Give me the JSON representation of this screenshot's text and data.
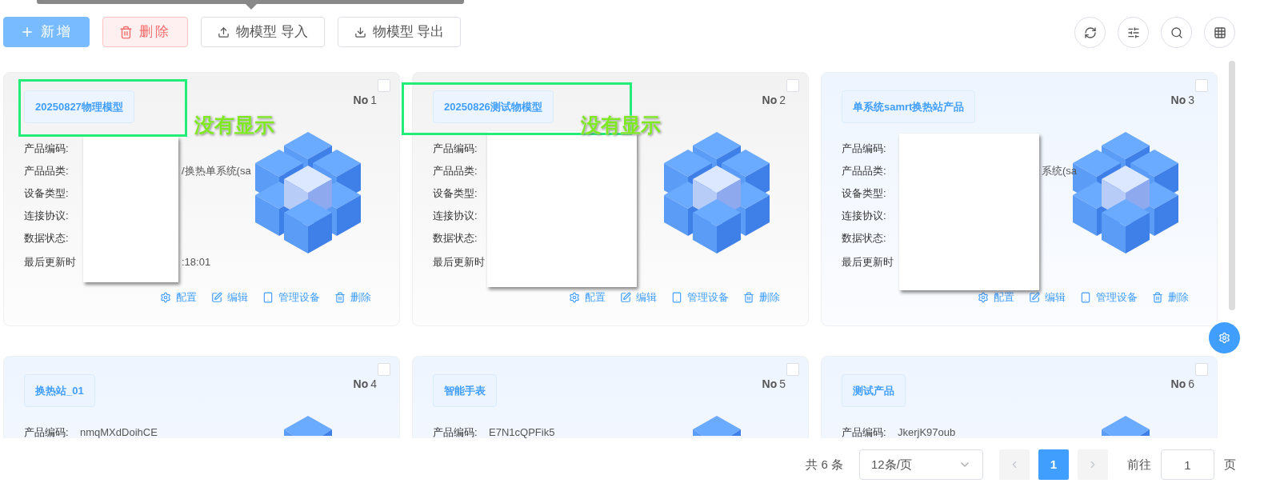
{
  "toolbar": {
    "buttons": [
      {
        "kind": "primary",
        "label": "新增"
      },
      {
        "kind": "danger",
        "label": "删除"
      },
      {
        "kind": "import",
        "label": "物模型 导入"
      },
      {
        "kind": "export",
        "label": "物模型 导出"
      }
    ],
    "tools": [
      {
        "kind": "refresh"
      },
      {
        "kind": "filter"
      },
      {
        "kind": "search"
      },
      {
        "kind": "columns"
      }
    ]
  },
  "cards": [
    {
      "title": "20250827物理模型",
      "number_label": "No",
      "number": "1",
      "highlighted": true,
      "checked": false,
      "annotation": "没有显示",
      "fields": [
        {
          "label": "产品编码:"
        },
        {
          "label": "产品品类:",
          "value": "/换热单系统(sa"
        },
        {
          "label": "设备类型:"
        },
        {
          "label": "连接协议:"
        },
        {
          "label": "数据状态:"
        },
        {
          "label": "最后更新时",
          "value": ":18:01"
        }
      ],
      "actions": [
        {
          "kind": "config",
          "label": "配置"
        },
        {
          "kind": "edit",
          "label": "编辑"
        },
        {
          "kind": "devices",
          "label": "管理设备"
        },
        {
          "kind": "delete",
          "label": "删除"
        }
      ]
    },
    {
      "title": "20250826测试物模型",
      "number_label": "No",
      "number": "2",
      "highlighted": true,
      "checked": false,
      "annotation": "没有显示",
      "fields": [
        {
          "label": "产品编码:"
        },
        {
          "label": "产品品类:"
        },
        {
          "label": "设备类型:"
        },
        {
          "label": "连接协议:"
        },
        {
          "label": "数据状态:"
        },
        {
          "label": "最后更新时"
        }
      ],
      "actions": [
        {
          "kind": "config",
          "label": "配置"
        },
        {
          "kind": "edit",
          "label": "编辑"
        },
        {
          "kind": "devices",
          "label": "管理设备"
        },
        {
          "kind": "delete",
          "label": "删除"
        }
      ]
    },
    {
      "title": "单系统samrt换热站产品",
      "number_label": "No",
      "number": "3",
      "highlighted": false,
      "checked": false,
      "fields": [
        {
          "label": "产品编码:"
        },
        {
          "label": "产品品类:",
          "value": "系统(sa"
        },
        {
          "label": "设备类型:"
        },
        {
          "label": "连接协议:"
        },
        {
          "label": "数据状态:"
        },
        {
          "label": "最后更新时"
        }
      ],
      "actions": [
        {
          "kind": "config",
          "label": "配置"
        },
        {
          "kind": "edit",
          "label": "编辑"
        },
        {
          "kind": "devices",
          "label": "管理设备"
        },
        {
          "kind": "delete",
          "label": "删除"
        }
      ]
    },
    {
      "title": "换热站_01",
      "number_label": "No",
      "number": "4",
      "highlighted": false,
      "checked": false,
      "fields": [
        {
          "label": "产品编码:",
          "value": "nmqMXdDoihCE"
        }
      ]
    },
    {
      "title": "智能手表",
      "number_label": "No",
      "number": "5",
      "highlighted": false,
      "checked": false,
      "fields": [
        {
          "label": "产品编码:",
          "value": "E7N1cQPFik5"
        }
      ]
    },
    {
      "title": "测试产品",
      "number_label": "No",
      "number": "6",
      "highlighted": false,
      "checked": false,
      "fields": [
        {
          "label": "产品编码:",
          "value": "JkerjK97oub"
        }
      ]
    }
  ],
  "pagination": {
    "total": "共 6 条",
    "page_size": "12条/页",
    "prev_disabled": true,
    "next_disabled": true,
    "pages": [
      {
        "label": "1",
        "selected": true
      }
    ],
    "goto_label": "前往",
    "goto_value": "1",
    "page_suffix": "页"
  }
}
